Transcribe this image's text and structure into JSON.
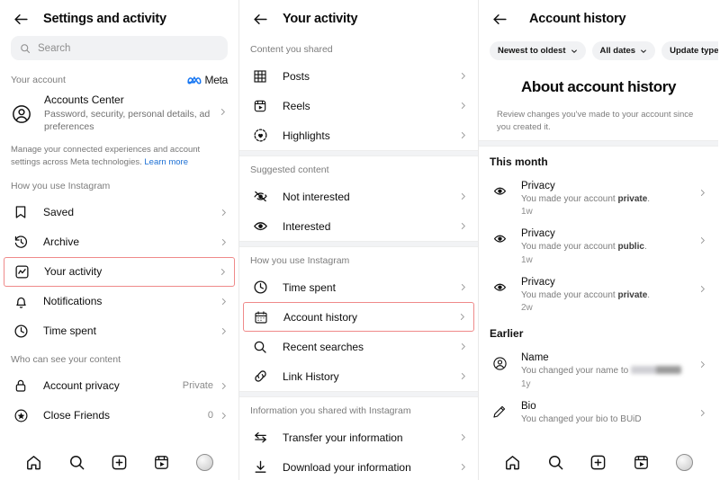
{
  "panel1": {
    "title": "Settings and activity",
    "back_icon": "back-arrow-icon",
    "search": {
      "placeholder": "Search",
      "icon": "search-icon"
    },
    "your_account_label": "Your account",
    "meta_label": "Meta",
    "accounts_center": {
      "title": "Accounts Center",
      "subtitle": "Password, security, personal details, ad preferences",
      "icon": "account-circle-icon"
    },
    "note": "Manage your connected experiences and account settings across Meta technologies.",
    "note_link": "Learn more",
    "sections": [
      {
        "label": "How you use Instagram",
        "items": [
          {
            "label": "Saved",
            "icon": "bookmark-icon",
            "highlighted": false,
            "value": ""
          },
          {
            "label": "Archive",
            "icon": "archive-clock-icon",
            "highlighted": false,
            "value": ""
          },
          {
            "label": "Your activity",
            "icon": "activity-chart-icon",
            "highlighted": true,
            "value": ""
          },
          {
            "label": "Notifications",
            "icon": "bell-icon",
            "highlighted": false,
            "value": ""
          },
          {
            "label": "Time spent",
            "icon": "clock-icon",
            "highlighted": false,
            "value": ""
          }
        ]
      },
      {
        "label": "Who can see your content",
        "items": [
          {
            "label": "Account privacy",
            "icon": "lock-icon",
            "highlighted": false,
            "value": "Private"
          },
          {
            "label": "Close Friends",
            "icon": "star-circle-icon",
            "highlighted": false,
            "value": "0"
          }
        ]
      }
    ]
  },
  "panel2": {
    "title": "Your activity",
    "back_icon": "back-arrow-icon",
    "sections": [
      {
        "label": "Content you shared",
        "items": [
          {
            "label": "Posts",
            "icon": "grid-icon",
            "highlighted": false
          },
          {
            "label": "Reels",
            "icon": "reels-icon",
            "highlighted": false
          },
          {
            "label": "Highlights",
            "icon": "highlights-heart-icon",
            "highlighted": false
          }
        ]
      },
      {
        "label": "Suggested content",
        "items": [
          {
            "label": "Not interested",
            "icon": "eye-slash-icon",
            "highlighted": false
          },
          {
            "label": "Interested",
            "icon": "eye-icon",
            "highlighted": false
          }
        ]
      },
      {
        "label": "How you use Instagram",
        "items": [
          {
            "label": "Time spent",
            "icon": "clock-icon",
            "highlighted": false
          },
          {
            "label": "Account history",
            "icon": "calendar-icon",
            "highlighted": true
          },
          {
            "label": "Recent searches",
            "icon": "search-icon",
            "highlighted": false
          },
          {
            "label": "Link History",
            "icon": "link-icon",
            "highlighted": false
          }
        ]
      },
      {
        "label": "Information you shared with Instagram",
        "items": [
          {
            "label": "Transfer your information",
            "icon": "transfer-arrows-icon",
            "highlighted": false
          },
          {
            "label": "Download your information",
            "icon": "download-icon",
            "highlighted": false
          }
        ]
      }
    ]
  },
  "panel3": {
    "title": "Account history",
    "back_icon": "back-arrow-icon",
    "filters": [
      {
        "label": "Newest to oldest",
        "icon": "chevron-down-icon"
      },
      {
        "label": "All dates",
        "icon": "chevron-down-icon"
      },
      {
        "label": "Update type",
        "icon": "chevron-down-icon"
      }
    ],
    "about_title": "About account history",
    "about_subtitle": "Review changes you've made to your account since you created it.",
    "groups": [
      {
        "label": "This month",
        "entries": [
          {
            "title": "Privacy",
            "desc_before": "You made your account ",
            "desc_strong": "private",
            "desc_after": ".",
            "time": "1w",
            "icon": "eye-icon"
          },
          {
            "title": "Privacy",
            "desc_before": "You made your account ",
            "desc_strong": "public",
            "desc_after": ".",
            "time": "1w",
            "icon": "eye-icon"
          },
          {
            "title": "Privacy",
            "desc_before": "You made your account ",
            "desc_strong": "private",
            "desc_after": ".",
            "time": "2w",
            "icon": "eye-icon"
          }
        ]
      },
      {
        "label": "Earlier",
        "entries": [
          {
            "title": "Name",
            "desc_before": "You changed your name to ",
            "desc_strong": "",
            "desc_after": "",
            "redacted": true,
            "time": "1y",
            "icon": "account-circle-icon"
          },
          {
            "title": "Bio",
            "desc_before": "You changed your bio to BUiD",
            "desc_strong": "",
            "desc_after": "",
            "blurred": true,
            "time": "",
            "icon": "pencil-icon"
          }
        ]
      }
    ]
  },
  "bottom_nav": [
    {
      "icon": "home-icon",
      "label": "Home"
    },
    {
      "icon": "search-icon",
      "label": "Search"
    },
    {
      "icon": "create-plus-icon",
      "label": "Create"
    },
    {
      "icon": "reels-icon",
      "label": "Reels"
    },
    {
      "icon": "profile-avatar-icon",
      "label": "Profile"
    }
  ],
  "colors": {
    "highlight_border": "#ef8a8a",
    "meta_blue": "#1877f2",
    "link": "#1b6fd4"
  }
}
